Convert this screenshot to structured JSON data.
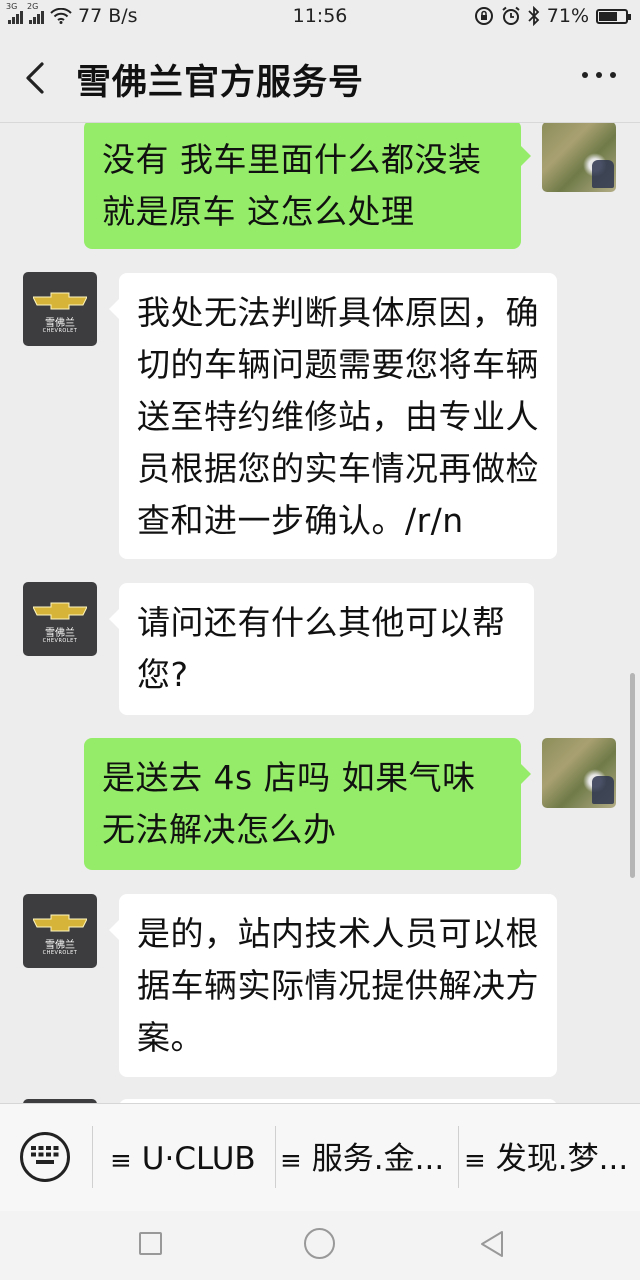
{
  "status_bar": {
    "network_1": "3G",
    "network_2": "2G",
    "speed": "77 B/s",
    "time": "11:56",
    "battery": "71%",
    "battery_level": 0.71,
    "icons": [
      "signal-icon",
      "wifi-icon",
      "lock-rotation-icon",
      "alarm-icon",
      "bluetooth-icon",
      "battery-icon"
    ]
  },
  "header": {
    "title": "雪佛兰官方服务号",
    "back_icon": "back-chevron-icon",
    "more_icon": "more-dots-icon"
  },
  "bot": {
    "logo_cn": "雪佛兰",
    "logo_en": "CHEVROLET",
    "accent": "#d6b43a"
  },
  "messages": [
    {
      "from": "user",
      "text": "没有  我车里面什么都没装  就是原车  这怎么处理"
    },
    {
      "from": "bot",
      "text": "我处无法判断具体原因，确切的车辆问题需要您将车辆送至特约维修站，由专业人员根据您的实车情况再做检查和进一步确认。/r/n"
    },
    {
      "from": "bot",
      "text": "请问还有什么其他可以帮您?"
    },
    {
      "from": "user",
      "text": "是送去 4s 店吗  如果气味无法解决怎么办"
    },
    {
      "from": "bot",
      "text": "是的，站内技术人员可以根据车辆实际情况提供解决方案。"
    }
  ],
  "menu": {
    "keyboard_icon": "keyboard-icon",
    "items": [
      {
        "label": "U·CLUB",
        "icon": "menu-lines-icon"
      },
      {
        "label": "服务.金...",
        "icon": "menu-lines-icon"
      },
      {
        "label": "发现.梦...",
        "icon": "menu-lines-icon"
      }
    ]
  },
  "colors": {
    "background": "#ededed",
    "bubble_out": "#95ec69",
    "bubble_in": "#ffffff"
  }
}
